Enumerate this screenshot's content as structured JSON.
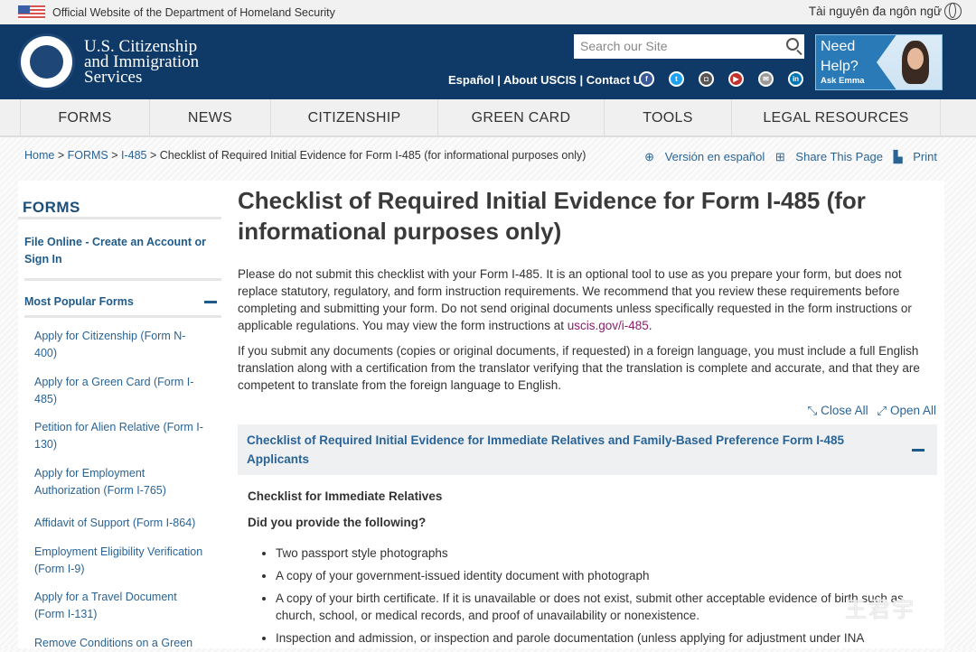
{
  "topbar": {
    "official": "Official Website of the Department of Homeland Security",
    "language": "Tài nguyên đa ngôn ngữ"
  },
  "header": {
    "agency": [
      "U.S. Citizenship",
      "and Immigration",
      "Services"
    ],
    "search_placeholder": "Search our Site",
    "links": [
      "Español",
      "About USCIS",
      "Contact Us"
    ],
    "social": [
      "facebook",
      "twitter",
      "instagram",
      "youtube",
      "email",
      "linkedin"
    ],
    "emma": {
      "title1": "Need",
      "title2": "Help?",
      "subtitle": "Ask Emma"
    }
  },
  "nav": [
    "FORMS",
    "NEWS",
    "CITIZENSHIP",
    "GREEN CARD",
    "TOOLS",
    "LEGAL RESOURCES"
  ],
  "breadcrumb": {
    "items": [
      "Home",
      "FORMS",
      "I-485"
    ],
    "current": "Checklist of Required Initial Evidence for Form I-485 (for informational purposes only)"
  },
  "tools": {
    "spanish": "Versión en español",
    "share": "Share This Page",
    "print": "Print"
  },
  "sidebar": {
    "title": "FORMS",
    "file_online": "File Online - Create an Account or Sign In",
    "popular": "Most Popular Forms",
    "items": [
      "Apply for Citizenship (Form N-400)",
      "Apply for a Green Card (Form I-485)",
      "Petition for Alien Relative (Form I-130)",
      "Apply for Employment Authorization (Form I-765)",
      "Affidavit of Support (Form I-864)",
      "Employment Eligibility Verification (Form I-9)",
      "Apply for a Travel Document (Form I-131)",
      "Remove Conditions on a Green"
    ]
  },
  "main": {
    "title": "Checklist of Required Initial Evidence for Form I-485 (for informational purposes only)",
    "p1": "Please do not submit this checklist with your Form I-485. It is an optional tool to use as you prepare your form, but does not replace statutory, regulatory, and form instruction requirements. We recommend that you review these requirements before completing and submitting your form. Do not send original documents unless specifically requested in the form instructions or applicable regulations. You may view the form instructions at ",
    "p1_link": "uscis.gov/i-485",
    "p1_end": ".",
    "p2": "If you submit any documents (copies or original documents, if requested) in a foreign language, you must include a full English translation along with a certification from the translator verifying that the translation is complete and accurate, and that they are competent to translate from the foreign language to English.",
    "close_all": "Close All",
    "open_all": "Open All",
    "accordion": "Checklist of Required Initial Evidence for Immediate Relatives and Family-Based Preference Form I-485 Applicants",
    "sub_heading": "Checklist for Immediate Relatives",
    "question": "Did you provide the following?",
    "bullets": [
      "Two passport style photographs",
      "A copy of your government-issued identity document with photograph",
      "A copy of your birth certificate. If it is unavailable or does not exist, submit other acceptable evidence of birth such as church, school, or medical records, and proof of unavailability or nonexistence.",
      "Inspection and admission, or inspection and parole documentation (unless applying for adjustment under INA"
    ]
  },
  "watermark": "王君宇"
}
